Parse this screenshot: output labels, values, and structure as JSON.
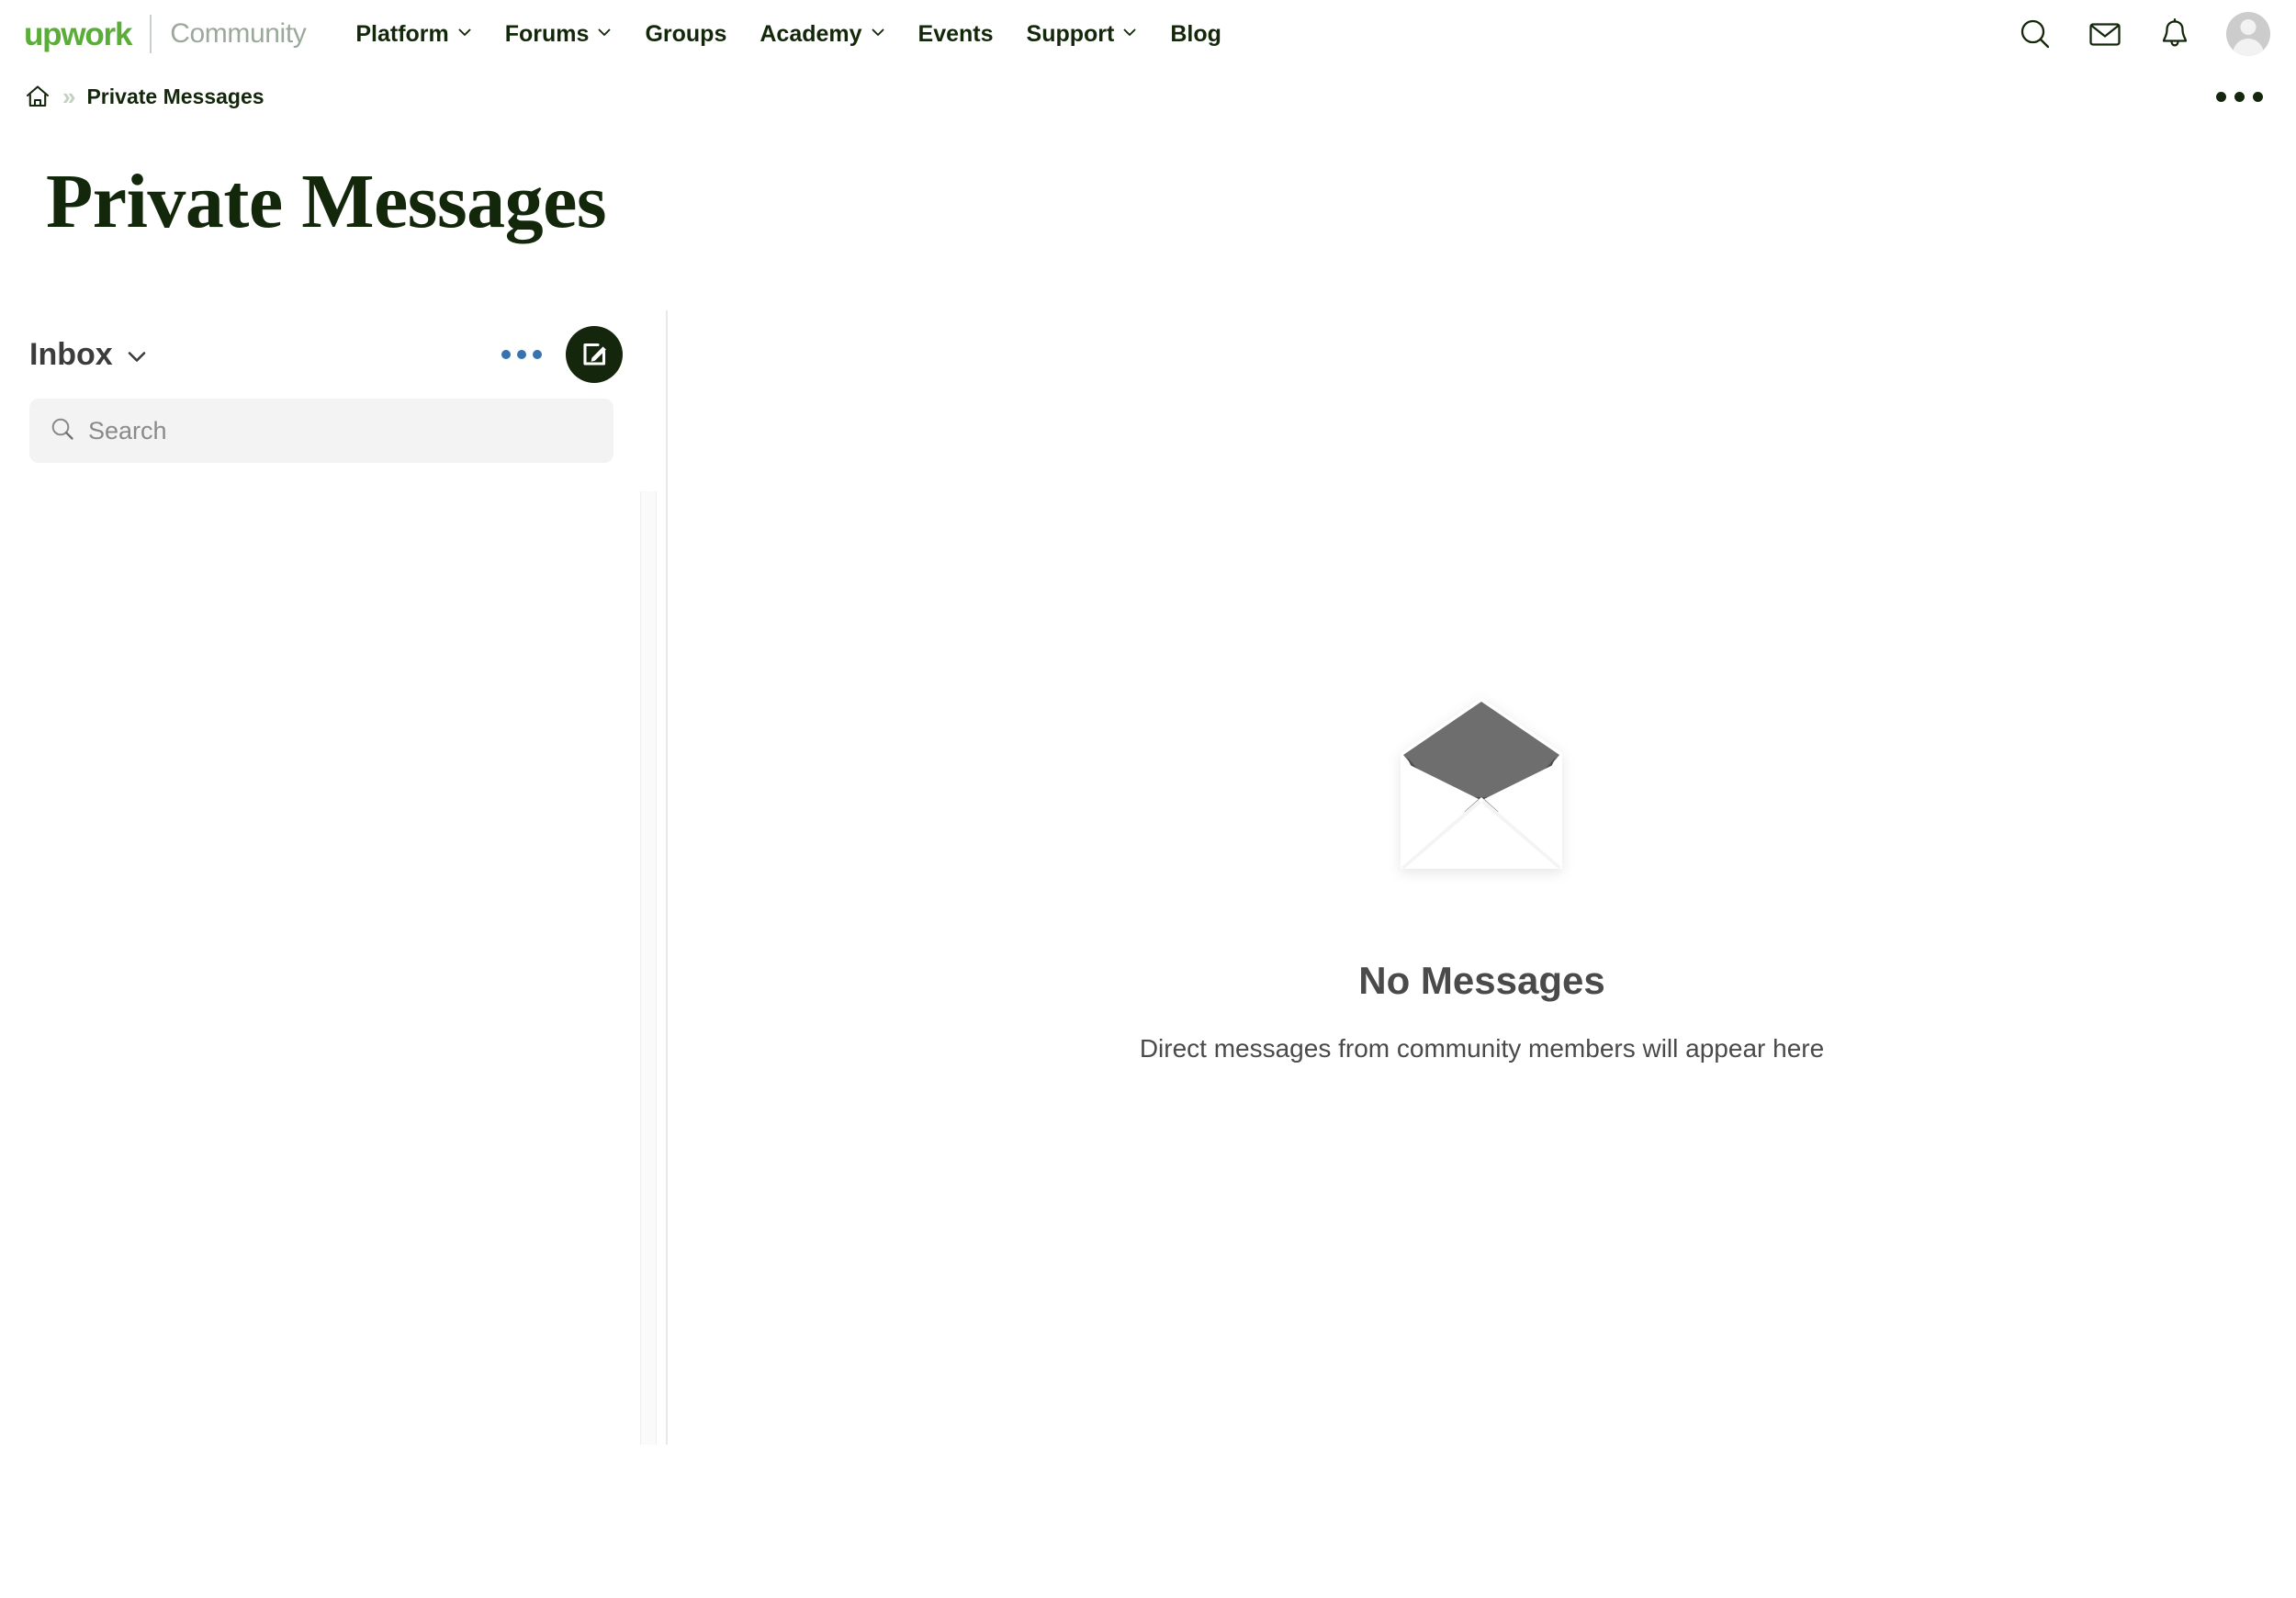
{
  "header": {
    "brand_logo": "upwork",
    "brand_sub": "Community",
    "nav": [
      {
        "label": "Platform",
        "has_caret": true,
        "icon": "chevron-down-icon"
      },
      {
        "label": "Forums",
        "has_caret": true,
        "icon": "chevron-down-icon"
      },
      {
        "label": "Groups",
        "has_caret": false,
        "icon": ""
      },
      {
        "label": "Academy",
        "has_caret": true,
        "icon": "chevron-down-icon"
      },
      {
        "label": "Events",
        "has_caret": false,
        "icon": ""
      },
      {
        "label": "Support",
        "has_caret": true,
        "icon": "chevron-down-icon"
      },
      {
        "label": "Blog",
        "has_caret": false,
        "icon": ""
      }
    ],
    "icons": [
      "search-icon",
      "envelope-icon",
      "bell-icon",
      "avatar"
    ]
  },
  "breadcrumb": {
    "home_icon": "home-icon",
    "separator": "»",
    "current": "Private Messages",
    "overflow_icon": "more-horizontal-icon"
  },
  "page": {
    "title": "Private Messages"
  },
  "sidebar": {
    "folder_label": "Inbox",
    "folder_caret_icon": "chevron-down-icon",
    "options_icon": "more-horizontal-icon",
    "compose_icon": "compose-icon",
    "search": {
      "icon": "search-icon",
      "value": "",
      "placeholder": "Search"
    },
    "conversations": []
  },
  "main": {
    "empty_state": {
      "illustration": "open-envelope-illustration",
      "title": "No Messages",
      "subtitle": "Direct messages from community members will appear here"
    }
  },
  "colors": {
    "brand_green": "#5AAD39",
    "brand_sub_gray": "#9BA99B",
    "dark_green": "#14270C",
    "accent_blue": "#3573B1",
    "search_bg": "#F2F3F2",
    "muted_text": "#4A4A4A",
    "envelope_flap": "#6E6E6E",
    "envelope_flap_shadow": "#4D4D4D"
  }
}
